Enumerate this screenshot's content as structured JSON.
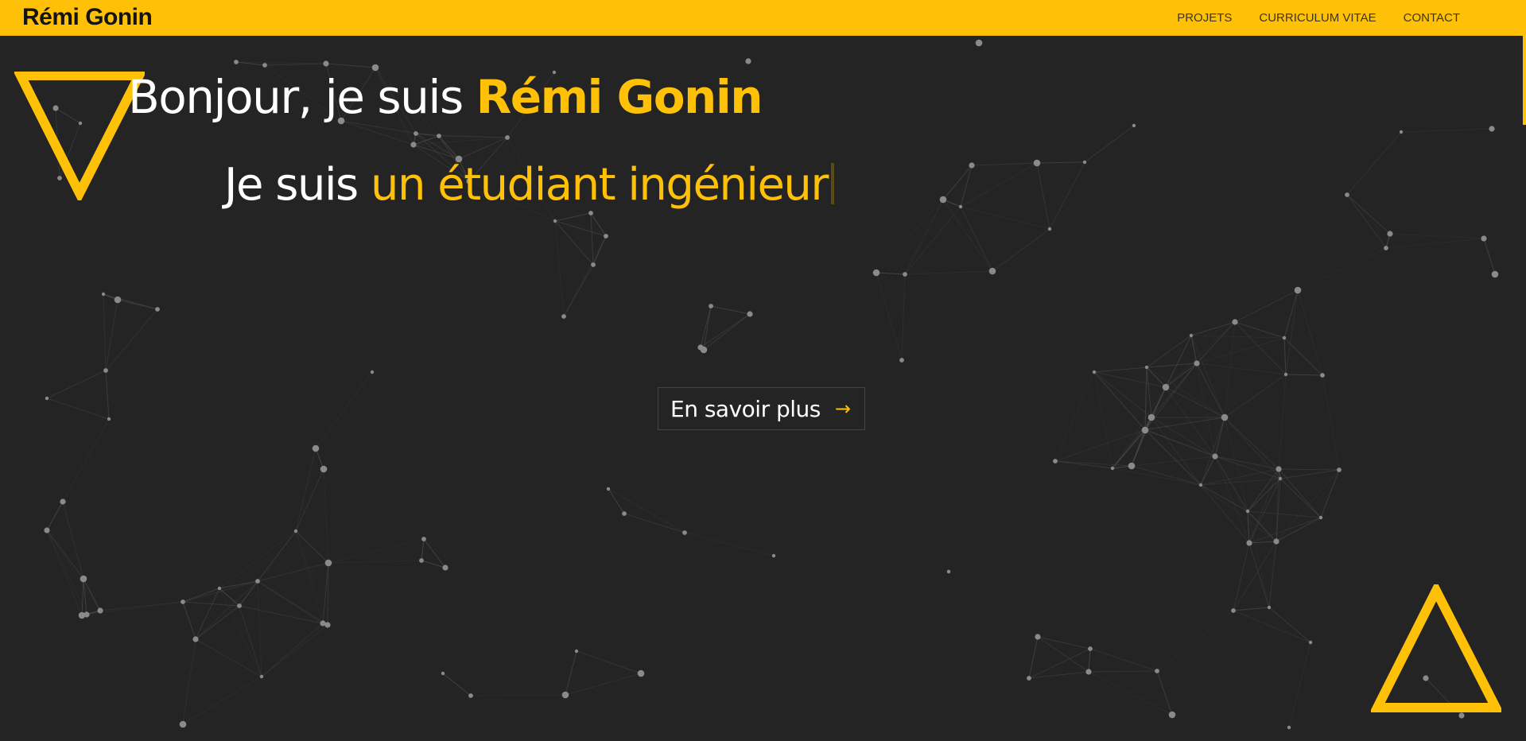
{
  "header": {
    "brand": "Rémi Gonin",
    "nav": [
      {
        "label": "PROJETS"
      },
      {
        "label": "CURRICULUM VITAE"
      },
      {
        "label": "CONTACT"
      }
    ]
  },
  "hero": {
    "greeting": "Bonjour, je suis ",
    "name": "Rémi Gonin",
    "sub_prefix": "Je suis ",
    "sub_role": "un étudiant ingénieur",
    "cta_label": "En savoir plus",
    "cta_icon": "arrow-right-icon"
  },
  "colors": {
    "accent": "#fec107",
    "background": "#242424",
    "text": "#ffffff"
  }
}
